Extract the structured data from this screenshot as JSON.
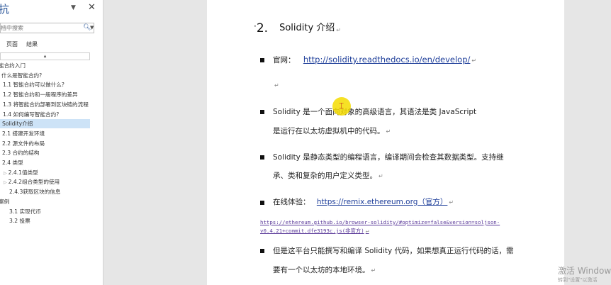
{
  "nav": {
    "title": "导航",
    "title_visible": "抗",
    "dropdown_icon": "triangle-down",
    "close_label": "✕",
    "search_placeholder": "档中搜索",
    "tabs": [
      "页面",
      "结果"
    ],
    "collapse_label": "▴",
    "items": [
      {
        "label": "能合约入门",
        "indent": 0,
        "selected": false
      },
      {
        "label": "什么是智能合约?",
        "indent": 1,
        "selected": false
      },
      {
        "label": "1.1 智能合约可以做什么?",
        "indent": 2,
        "selected": false
      },
      {
        "label": "1.2 智能合约和一般程序的差异",
        "indent": 2,
        "selected": false
      },
      {
        "label": "1.3 将智能合约部署到区块链的流程",
        "indent": 2,
        "selected": false
      },
      {
        "label": "1.4 如何编写智能合约?",
        "indent": 2,
        "selected": false
      },
      {
        "label": "Solidity介绍",
        "indent": 1,
        "selected": true
      },
      {
        "label": "2.1 搭建开发环境",
        "indent": 2,
        "selected": false
      },
      {
        "label": "2.2 源文件的布局",
        "indent": 2,
        "selected": false
      },
      {
        "label": "2.3 合约的结构",
        "indent": 2,
        "selected": false
      },
      {
        "label": "2.4 类型",
        "indent": 2,
        "selected": false
      },
      {
        "label": "2.4.1值类型",
        "indent": 3,
        "selected": false,
        "expander": true
      },
      {
        "label": "2.4.2组合类型的使用",
        "indent": 3,
        "selected": false,
        "expander": true
      },
      {
        "label": "2.4.3获取区块的信息",
        "indent": 3,
        "selected": false
      },
      {
        "label": "案例",
        "indent": 0,
        "selected": false
      },
      {
        "label": "3.1 实现代币",
        "indent": 4,
        "selected": false
      },
      {
        "label": "3.2 投票",
        "indent": 4,
        "selected": false
      }
    ]
  },
  "document": {
    "heading_number": "2.",
    "heading_text": "Solidity 介绍",
    "official_label": "官网：",
    "official_link": "http://solidity.readthedocs.io/en/develop/",
    "para1_line1": "Solidity 是一个面向对象的高级语言，其语法是类 JavaScript",
    "para1_line2": "是运行在以太坊虚拟机中的代码。",
    "para2_line1": "Solidity  是静态类型的编程语言，编译期间会检查其数据类型。支持继",
    "para2_line2": "承、类和复杂的用户定义类型。",
    "online_label": "在线体验：",
    "online_link": "https://remix.ethereum.org（官方）",
    "small_link_line1": "https://ethereum.github.io/browser-solidity/#optimize=false&version=soljson-",
    "small_link_line2": "v0.4.21+commit.dfe3193c.js(非官方)",
    "para3_line1": "但是这平台只能撰写和编译 Solidity 代码，如果想真正运行代码的话，需",
    "para3_line2": "要有一个以太坊的本地环境。",
    "para_mark": "↵"
  },
  "overlay": {
    "watermark": "激活 Windows",
    "watermark_sub": "转到\"设置\"以激活"
  },
  "colors": {
    "selected_bg": "#cde3f7",
    "link": "#1f3f9a",
    "cursor_highlight": "#f5dc00"
  }
}
